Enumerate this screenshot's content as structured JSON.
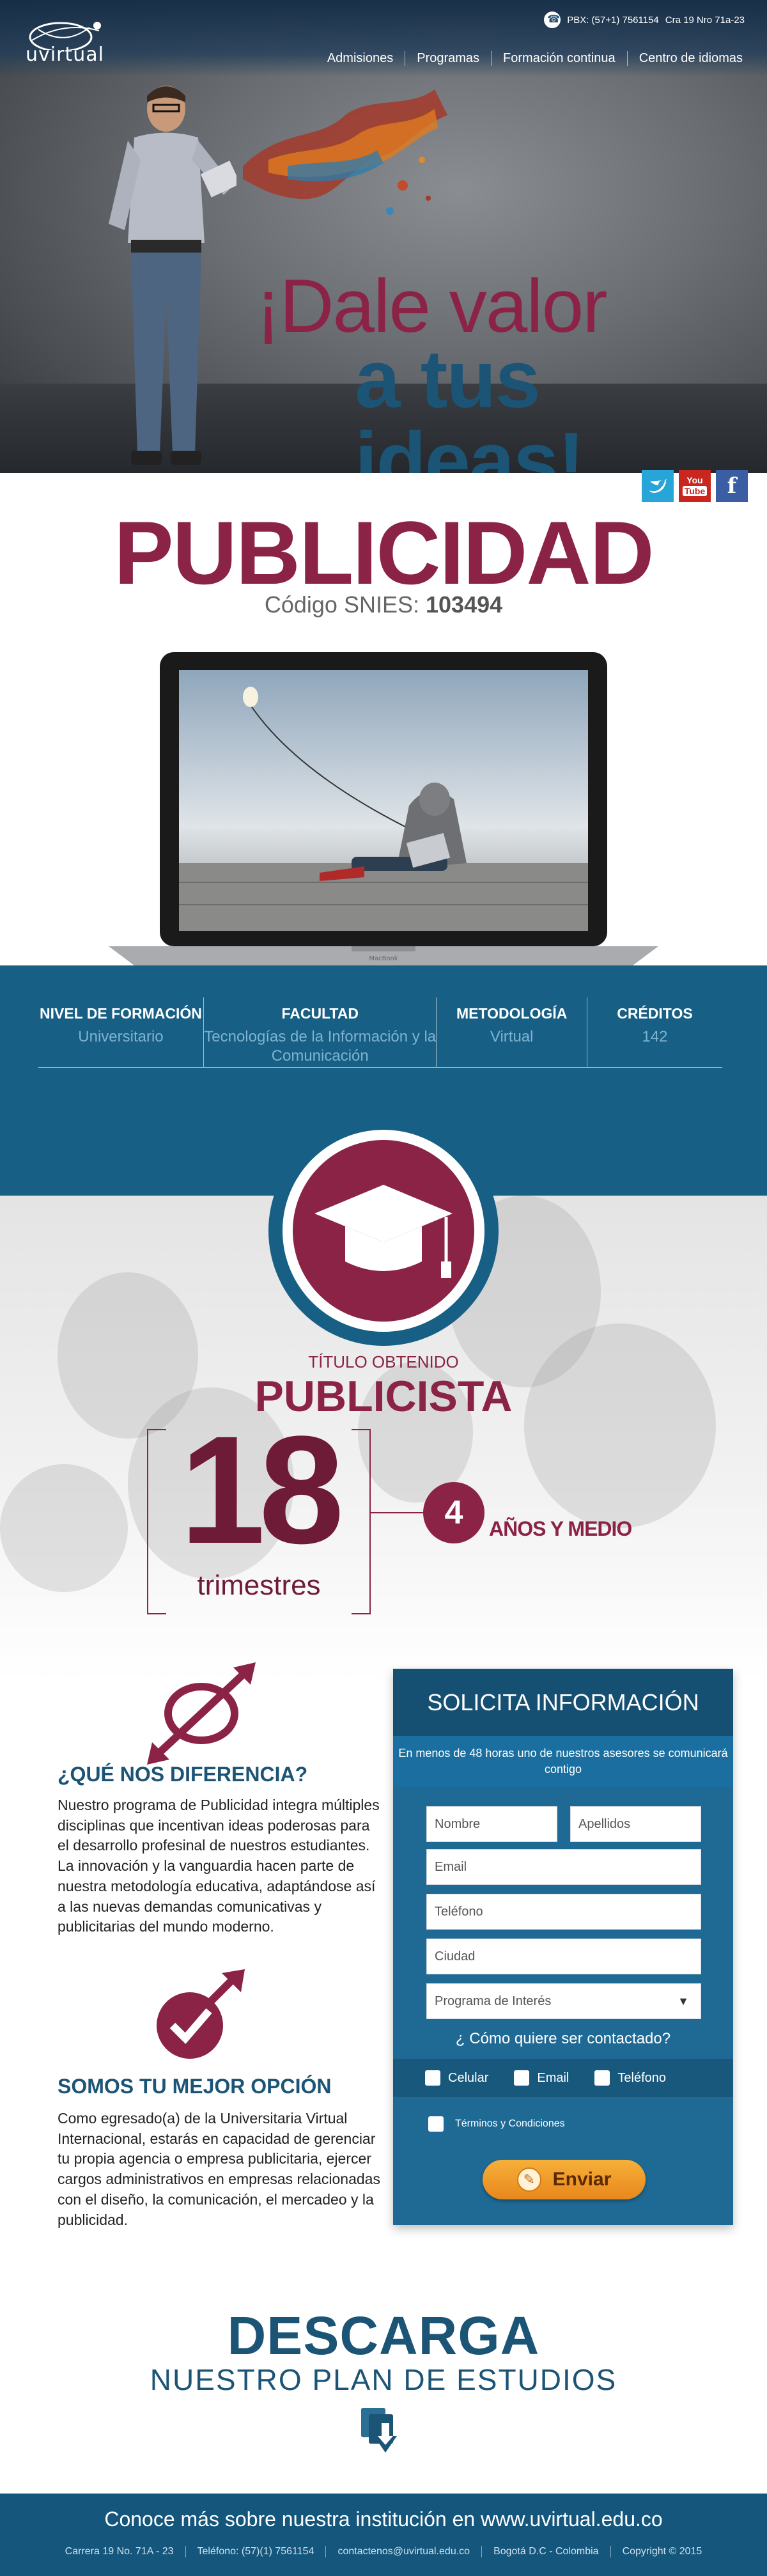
{
  "header": {
    "logo": "uvirtual",
    "phone": "PBX: (57+1) 7561154",
    "address": "Cra 19 Nro 71a-23",
    "nav": [
      "Admisiones",
      "Programas",
      "Formación continua",
      "Centro de idiomas"
    ]
  },
  "hero": {
    "line1": "¡Dale valor",
    "line2": "a tus ideas!"
  },
  "social": {
    "twitter": "twitter-icon",
    "youtube_top": "You",
    "youtube_bottom": "Tube",
    "facebook": "f"
  },
  "program": {
    "title": "PUBLICIDAD",
    "snies_label": "Código SNIES:",
    "snies_code": "103494",
    "laptop_brand": "MacBook"
  },
  "info": [
    {
      "label": "NIVEL DE FORMACIÓN",
      "value": "Universitario"
    },
    {
      "label": "FACULTAD",
      "value": "Tecnologías de la Información y la Comunicación"
    },
    {
      "label": "METODOLOGÍA",
      "value": "Virtual"
    },
    {
      "label": "CRÉDITOS",
      "value": "142"
    }
  ],
  "titulo": {
    "label": "TÍTULO OBTENIDO",
    "value": "PUBLICISTA",
    "duration_number": "18",
    "duration_unit": "trimestres",
    "years": "4",
    "years_label": "AÑOS Y MEDIO"
  },
  "features": [
    {
      "title": "¿QUÉ NOS DIFERENCIA?",
      "text": "Nuestro programa de Publicidad integra múltiples disciplinas que incentivan ideas poderosas para el desarrollo profesinal de nuestros estudiantes. La innovación y la vanguardia hacen parte de nuestra metodología educativa, adaptándose así a las nuevas demandas comunicativas y publicitarias del mundo moderno."
    },
    {
      "title": "SOMOS TU MEJOR OPCIÓN",
      "text": "Como egresado(a) de la Universitaria Virtual Internacional,  estarás en capacidad de gerenciar tu propia agencia o empresa publicitaria, ejercer cargos administrativos en empresas relacionadas con el diseño, la comunicación, el mercadeo y la publicidad."
    }
  ],
  "form": {
    "title": "SOLICITA INFORMACIÓN",
    "subtitle": "En menos de 48 horas uno de nuestros asesores se comunicará contigo",
    "nombre": "Nombre",
    "apellidos": "Apellidos",
    "email": "Email",
    "telefono": "Teléfono",
    "ciudad": "Ciudad",
    "programa": "Programa de Interés",
    "question": "¿ Cómo quiere ser contactado?",
    "opt_celular": "Celular",
    "opt_email": "Email",
    "opt_telefono": "Teléfono",
    "terms": "Términos y Condiciones",
    "submit": "Enviar"
  },
  "download": {
    "title": "DESCARGA",
    "subtitle": "NUESTRO PLAN DE ESTUDIOS"
  },
  "footer": {
    "main": "Conoce más sobre nuestra institución en www.uvirtual.edu.co",
    "items": [
      "Carrera 19 No. 71A - 23",
      "Teléfono: (57)(1) 7561154",
      "contactenos@uvirtual.edu.co",
      "Bogotá D.C - Colombia",
      "Copyright © 2015"
    ]
  },
  "colors": {
    "brand_blue": "#175f85",
    "brand_wine": "#8b2346",
    "accent_orange": "#f0a030"
  }
}
